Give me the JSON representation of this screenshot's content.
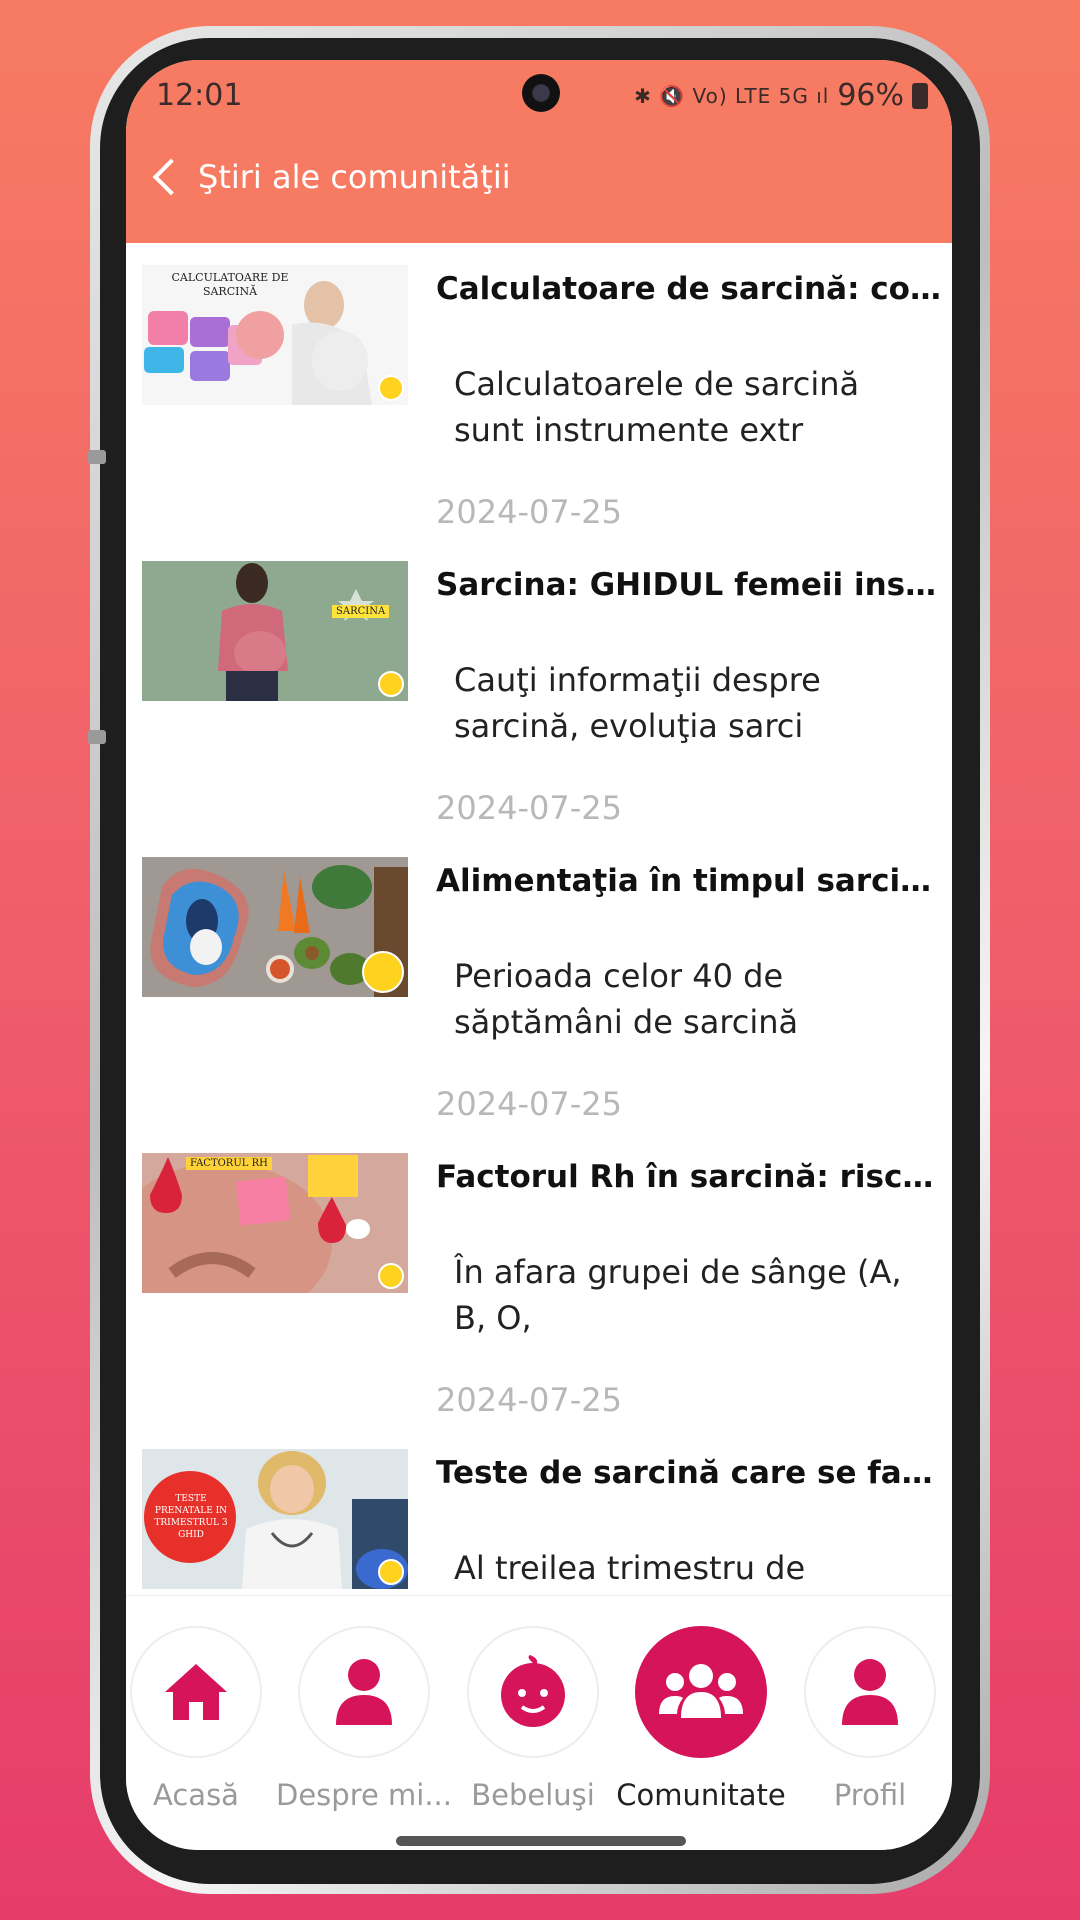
{
  "status_bar": {
    "time": "12:01",
    "indicators": "✱ 🔇 Vo) LTE 5G ıl",
    "battery": "96%"
  },
  "header": {
    "title": "Ştiri ale comunităţii",
    "accent_color": "#f77b62"
  },
  "articles": [
    {
      "title": "Calculatoare de sarcină: col...",
      "description": "Calculatoarele de sarcină sunt instrumente extr",
      "date": "2024-07-25",
      "thumb_text": "CALCULATOARE DE SARCINĂ"
    },
    {
      "title": "Sarcina: GHIDUL femeii insă...",
      "description": "Cauţi informaţii despre sarcină, evoluţia sarci",
      "date": "2024-07-25",
      "thumb_text": "SARCINA"
    },
    {
      "title": "Alimentaţia în timpul sarcin...",
      "description": "Perioada celor 40 de săptămâni de sarcină",
      "date": "2024-07-25",
      "thumb_text": ""
    },
    {
      "title": "Factorul Rh în sarcină: riscu...",
      "description": "În afara grupei de sânge (A, B, O,",
      "date": "2024-07-25",
      "thumb_text": "FACTORUL RH"
    },
    {
      "title": "Teste de sarcină care se fac ...",
      "description": "Al treilea trimestru de",
      "date": "",
      "thumb_text": "TESTE PRENATALE IN TRIMESTRUL 3 GHID"
    }
  ],
  "bottom_nav": {
    "active_color": "#d6145a",
    "items": [
      {
        "label": "Acasă",
        "icon": "home-icon",
        "active": false
      },
      {
        "label": "Despre mi...",
        "icon": "person-icon",
        "active": false
      },
      {
        "label": "Bebeluşi",
        "icon": "baby-icon",
        "active": false
      },
      {
        "label": "Comunitate",
        "icon": "group-icon",
        "active": true
      },
      {
        "label": "Profil",
        "icon": "profile-icon",
        "active": false
      }
    ]
  }
}
